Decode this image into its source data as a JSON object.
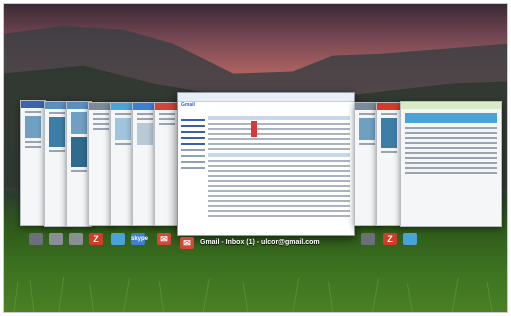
{
  "switcher": {
    "active_tab_title": "Gmail - Inbox (1) - ulcor@gmail.com",
    "gmail_logo_text": "Gmail"
  },
  "tab_icons_left": [
    {
      "name": "window-icon",
      "color": "#6a6f78"
    },
    {
      "name": "rss-icon",
      "color": "#8a8f96"
    },
    {
      "name": "page-icon",
      "color": "#8a8f96"
    },
    {
      "name": "zoho-z-icon",
      "color": "#d23b2a",
      "glyph": "Z"
    },
    {
      "name": "twitter-icon",
      "color": "#4aa3d6"
    },
    {
      "name": "skype-icon",
      "color": "#3f7fd0",
      "glyph": "skype"
    },
    {
      "name": "gmail-icon",
      "color": "#d44638"
    }
  ],
  "tab_icons_right": [
    {
      "name": "window-icon",
      "color": "#6a6f78"
    },
    {
      "name": "zoho-z-icon",
      "color": "#d23b2a",
      "glyph": "Z"
    },
    {
      "name": "twitter-icon",
      "color": "#4aa3d6"
    }
  ],
  "colors": {
    "gmail_blue": "#3366cc",
    "gmail_red": "#d44638"
  }
}
